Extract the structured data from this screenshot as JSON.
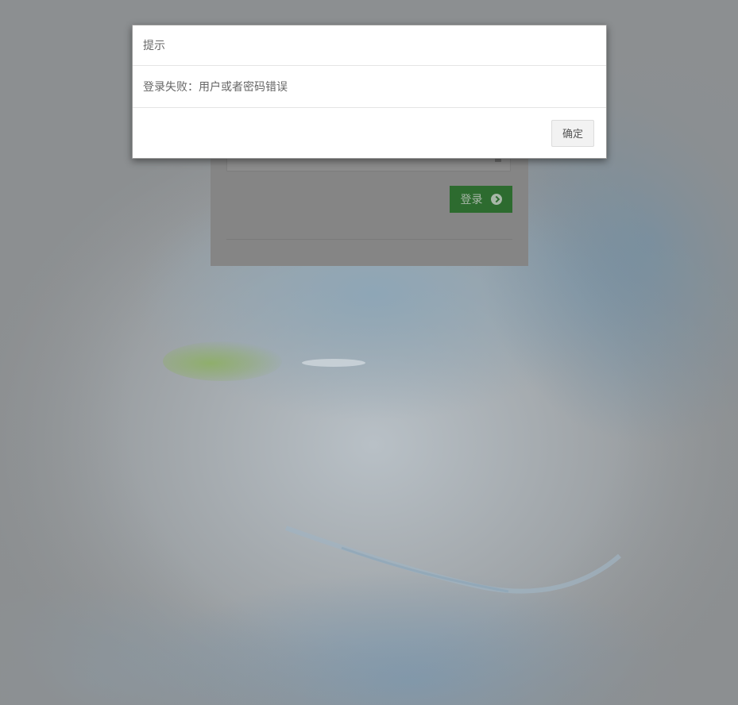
{
  "modal": {
    "title": "提示",
    "message": "登录失败：用户或者密码错误",
    "confirm_label": "确定"
  },
  "login": {
    "password_mask": "•••••••",
    "submit_label": "登录",
    "lock_icon": "lock-icon",
    "submit_icon": "arrow-circle-right-icon"
  },
  "colors": {
    "overlay": "#8c8f91",
    "login_button": "#2d6b2f",
    "modal_bg": "#ffffff"
  }
}
